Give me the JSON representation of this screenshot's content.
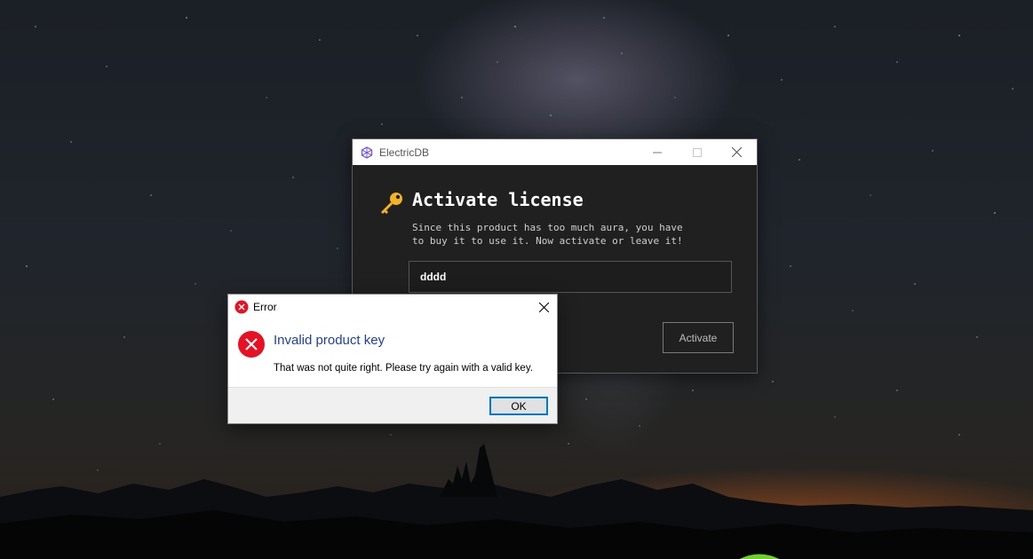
{
  "app_window": {
    "title": "ElectricDB",
    "heading": "Activate license",
    "subtitle_line1": "Since this product has too much aura, you have",
    "subtitle_line2": "to buy it to use it. Now activate or leave it!",
    "key_input_value": "dddd",
    "activate_label": "Activate",
    "window_buttons": [
      "minimize-icon",
      "maximize-icon",
      "close-icon"
    ],
    "accent_color": "#7b5cd6"
  },
  "error_dialog": {
    "title": "Error",
    "heading": "Invalid product key",
    "message": "That was not quite right. Please try again with a valid key.",
    "ok_label": "OK",
    "heading_color": "#1f3fa0",
    "icon": "error-circle-x-icon",
    "icon_color": "#e81123"
  }
}
